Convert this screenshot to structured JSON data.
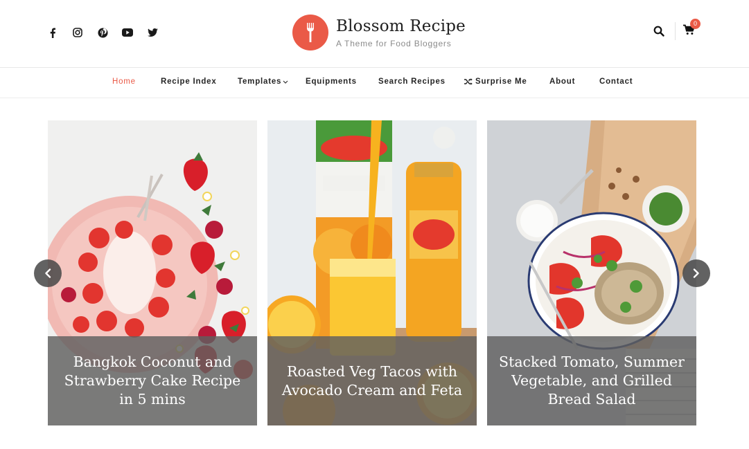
{
  "header": {
    "site_title": "Blossom Recipe",
    "tagline": "A Theme for Food Bloggers",
    "cart_count": "0",
    "social": [
      "facebook",
      "instagram",
      "pinterest",
      "youtube",
      "twitter"
    ],
    "brand_color": "#ea5a47"
  },
  "nav": {
    "items": [
      {
        "label": "Home",
        "active": true
      },
      {
        "label": "Recipe Index"
      },
      {
        "label": "Templates",
        "has_dropdown": true
      },
      {
        "label": "Equipments"
      },
      {
        "label": "Search Recipes"
      },
      {
        "label": "Surprise Me",
        "icon": "shuffle-icon"
      },
      {
        "label": "About"
      },
      {
        "label": "Contact"
      }
    ]
  },
  "slider": {
    "slides": [
      {
        "title": "Bangkok Coconut and Strawberry Cake Recipe in 5 mins"
      },
      {
        "title": "Roasted Veg Tacos with Avocado Cream and Feta"
      },
      {
        "title": "Stacked Tomato, Summer Vegetable, and Grilled Bread Salad"
      }
    ]
  }
}
